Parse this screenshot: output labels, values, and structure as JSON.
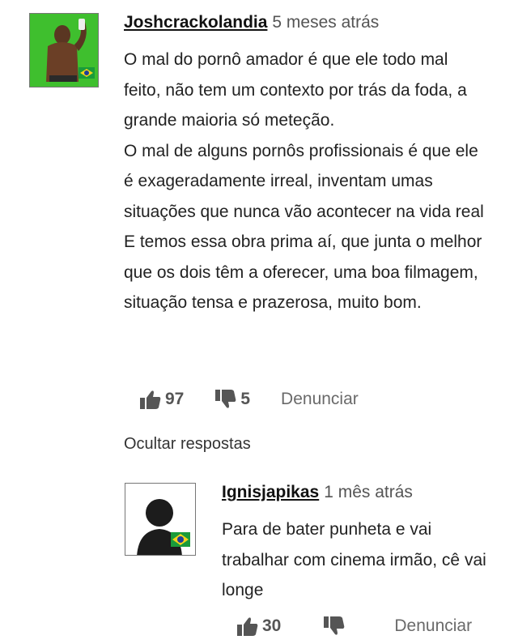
{
  "comments": [
    {
      "username": "Joshcrackolandia",
      "time": "5 meses atrás",
      "paragraphs": [
        "O mal do pornô amador é que ele todo mal feito, não tem um contexto por trás da foda, a grande maioria só meteção.",
        "O mal de alguns pornôs profissionais é que ele é exageradamente irreal, inventam umas situações que nunca vão acontecer na vida real",
        "E temos essa obra prima aí, que junta o melhor que os dois têm a oferecer, uma boa filmagem, situação tensa e prazerosa, muito bom."
      ],
      "likes": "97",
      "dislikes": "5",
      "report_label": "Denunciar"
    }
  ],
  "toggle_replies_label": "Ocultar respostas",
  "replies": [
    {
      "username": "Ignisjapikas",
      "time": "1 mês atrás",
      "paragraphs": [
        "Para de bater punheta e vai trabalhar com cinema irmão, cê vai longe"
      ],
      "likes": "30",
      "report_label": "Denunciar"
    }
  ],
  "icons": {
    "like": "thumbs-up-icon",
    "dislike": "thumbs-down-icon",
    "flag": "brazil-flag-icon"
  },
  "colors": {
    "avatar1_bg": "#3fbf2e",
    "flag_green": "#1a9b3a",
    "flag_yellow": "#f5d31a",
    "flag_blue": "#1f3f9a"
  }
}
